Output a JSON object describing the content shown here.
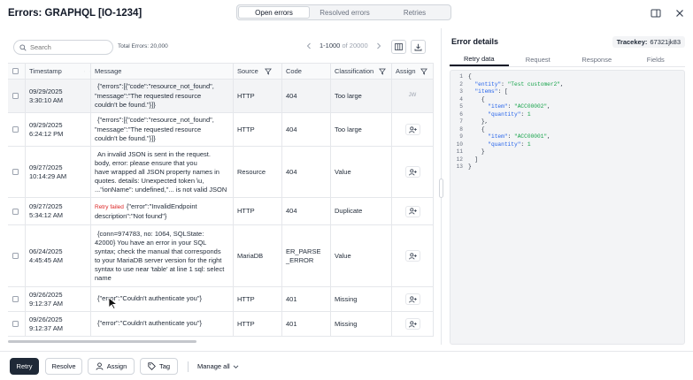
{
  "header": {
    "title": "Errors: GRAPHQL [IO-1234]",
    "tabs": [
      {
        "label": "Open errors",
        "active": true
      },
      {
        "label": "Resolved errors",
        "active": false
      },
      {
        "label": "Retries",
        "active": false
      }
    ],
    "icons": [
      "panel-toggle-icon",
      "close-icon"
    ]
  },
  "toolbar": {
    "search_placeholder": "Search",
    "total_label": "Total Errors: 20,000",
    "range_label": "1-1000",
    "of_label": "of 20000"
  },
  "table": {
    "columns": [
      "Timestamp",
      "Message",
      "Source",
      "Code",
      "Classification",
      "Assign"
    ],
    "rows": [
      {
        "timestamp": "09/29/2025\n3:30:10 AM",
        "badge": "",
        "message": "{\"errors\":[{\"code\":\"resource_not_found\",\n\"message\":\"The requested resource\ncouldn't be found.\"}]}",
        "source": "HTTP",
        "code": "404",
        "classification": "Too large",
        "assignee": "JW",
        "selected": true
      },
      {
        "timestamp": "09/29/2025\n6:24:12 PM",
        "badge": "",
        "message": "{\"errors\":[{\"code\":\"resource_not_found\",\n\"message\":\"The requested resource\ncouldn't be found.\"}]}",
        "source": "HTTP",
        "code": "404",
        "classification": "Too large",
        "assignee": "",
        "selected": false
      },
      {
        "timestamp": "09/27/2025\n10:14:29 AM",
        "badge": "",
        "message": "An invalid JSON is sent in the request.\nbody, error: please ensure that you\nhave wrapped all JSON property names in\nquotes. details: Unexpected token \\u,\n...\"ionName\": undefined,\"... is not valid JSON",
        "source": "Resource",
        "code": "404",
        "classification": "Value",
        "assignee": "",
        "selected": false
      },
      {
        "timestamp": "09/27/2025\n5:34:12 AM",
        "badge": "Retry failed",
        "message": "{\"error\":\"InvalidEndpoint\ndescription\":\"Not found\"}",
        "source": "HTTP",
        "code": "404",
        "classification": "Duplicate",
        "assignee": "",
        "selected": false
      },
      {
        "timestamp": "06/24/2025\n4:45:45 AM",
        "badge": "",
        "message": "{conn=974783, no: 1064, SQLState:\n42000} You have an error in your SQL\nsyntax; check the manual that corresponds\nto your MariaDB server version for the right\nsyntax to use near 'table' at line 1 sql: select\nname",
        "source": "MariaDB",
        "code": "ER_PARSE\n_ERROR",
        "classification": "Value",
        "assignee": "",
        "selected": false
      },
      {
        "timestamp": "09/26/2025\n9:12:37 AM",
        "badge": "",
        "message": "{\"error\":\"Couldn't authenticate you\"}",
        "source": "HTTP",
        "code": "401",
        "classification": "Missing",
        "assignee": "",
        "selected": false
      },
      {
        "timestamp": "09/26/2025\n9:12:37 AM",
        "badge": "",
        "message": "{\"error\":\"Couldn't authenticate you\"}",
        "source": "HTTP",
        "code": "401",
        "classification": "Missing",
        "assignee": "",
        "selected": false
      }
    ]
  },
  "details": {
    "title": "Error details",
    "tracekey_label": "Tracekey:",
    "tracekey_value": "67321jk83",
    "tabs": [
      {
        "label": "Retry data",
        "active": true
      },
      {
        "label": "Request",
        "active": false
      },
      {
        "label": "Response",
        "active": false
      },
      {
        "label": "Fields",
        "active": false
      }
    ],
    "code_lines": [
      [
        {
          "t": "p",
          "v": "{"
        }
      ],
      [
        {
          "t": "p",
          "v": "  "
        },
        {
          "t": "k",
          "v": "\"entity\""
        },
        {
          "t": "p",
          "v": ": "
        },
        {
          "t": "s",
          "v": "\"Test customer2\""
        },
        {
          "t": "p",
          "v": ","
        }
      ],
      [
        {
          "t": "p",
          "v": "  "
        },
        {
          "t": "k",
          "v": "\"items\""
        },
        {
          "t": "p",
          "v": ": ["
        }
      ],
      [
        {
          "t": "p",
          "v": "    {"
        }
      ],
      [
        {
          "t": "p",
          "v": "      "
        },
        {
          "t": "k",
          "v": "\"item\""
        },
        {
          "t": "p",
          "v": ": "
        },
        {
          "t": "s",
          "v": "\"ACC00002\""
        },
        {
          "t": "p",
          "v": ","
        }
      ],
      [
        {
          "t": "p",
          "v": "      "
        },
        {
          "t": "k",
          "v": "\"quantity\""
        },
        {
          "t": "p",
          "v": ": "
        },
        {
          "t": "n",
          "v": "1"
        }
      ],
      [
        {
          "t": "p",
          "v": "    },"
        }
      ],
      [
        {
          "t": "p",
          "v": "    {"
        }
      ],
      [
        {
          "t": "p",
          "v": "      "
        },
        {
          "t": "k",
          "v": "\"item\""
        },
        {
          "t": "p",
          "v": ": "
        },
        {
          "t": "s",
          "v": "\"ACC00001\""
        },
        {
          "t": "p",
          "v": ","
        }
      ],
      [
        {
          "t": "p",
          "v": "      "
        },
        {
          "t": "k",
          "v": "\"quantity\""
        },
        {
          "t": "p",
          "v": ": "
        },
        {
          "t": "n",
          "v": "1"
        }
      ],
      [
        {
          "t": "p",
          "v": "    }"
        }
      ],
      [
        {
          "t": "p",
          "v": "  ]"
        }
      ],
      [
        {
          "t": "p",
          "v": "}"
        }
      ]
    ]
  },
  "actions": {
    "retry": "Retry",
    "resolve": "Resolve",
    "assign": "Assign",
    "tag": "Tag",
    "manage_all": "Manage all"
  }
}
